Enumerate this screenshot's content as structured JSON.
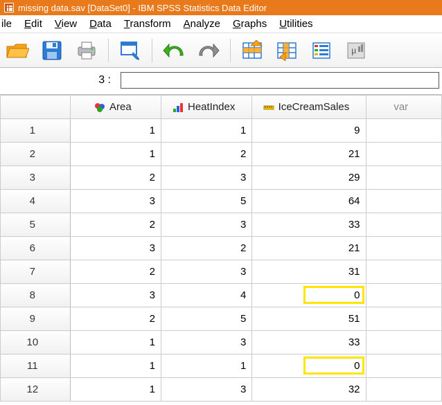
{
  "titlebar": {
    "text": "missing data.sav [DataSet0] - IBM SPSS Statistics Data Editor"
  },
  "menu": {
    "file": "ile",
    "file_ul": "i",
    "edit": "Edit",
    "edit_ul": "E",
    "view": "View",
    "view_ul": "V",
    "data": "Data",
    "data_ul": "D",
    "transform": "Transform",
    "transform_ul": "T",
    "analyze": "Analyze",
    "analyze_ul": "A",
    "graphs": "Graphs",
    "graphs_ul": "G",
    "utilities": "Utilities",
    "utilities_ul": "U"
  },
  "infobar": {
    "label": "3 :",
    "value": ""
  },
  "columns": {
    "rowheader": "",
    "area": "Area",
    "heatindex": "HeatIndex",
    "icecream": "IceCreamSales",
    "var": "var"
  },
  "rows": [
    {
      "n": "1",
      "area": "1",
      "heat": "1",
      "ice": "9",
      "hl": false
    },
    {
      "n": "2",
      "area": "1",
      "heat": "2",
      "ice": "21",
      "hl": false
    },
    {
      "n": "3",
      "area": "2",
      "heat": "3",
      "ice": "29",
      "hl": false
    },
    {
      "n": "4",
      "area": "3",
      "heat": "5",
      "ice": "64",
      "hl": false
    },
    {
      "n": "5",
      "area": "2",
      "heat": "3",
      "ice": "33",
      "hl": false
    },
    {
      "n": "6",
      "area": "3",
      "heat": "2",
      "ice": "21",
      "hl": false
    },
    {
      "n": "7",
      "area": "2",
      "heat": "3",
      "ice": "31",
      "hl": false
    },
    {
      "n": "8",
      "area": "3",
      "heat": "4",
      "ice": "0",
      "hl": true
    },
    {
      "n": "9",
      "area": "2",
      "heat": "5",
      "ice": "51",
      "hl": false
    },
    {
      "n": "10",
      "area": "1",
      "heat": "3",
      "ice": "33",
      "hl": false
    },
    {
      "n": "11",
      "area": "1",
      "heat": "1",
      "ice": "0",
      "hl": true
    },
    {
      "n": "12",
      "area": "1",
      "heat": "3",
      "ice": "32",
      "hl": false
    }
  ],
  "icons": {
    "open": "open-icon",
    "save": "save-icon",
    "print": "print-icon",
    "recall": "recall-icon",
    "undo": "undo-icon",
    "redo": "redo-icon",
    "goto_case": "goto-case-icon",
    "goto_var": "goto-var-icon",
    "variables": "variables-icon",
    "run": "run-icon"
  },
  "colors": {
    "titlebar": "#e97a1b",
    "highlight": "#ffe600"
  }
}
